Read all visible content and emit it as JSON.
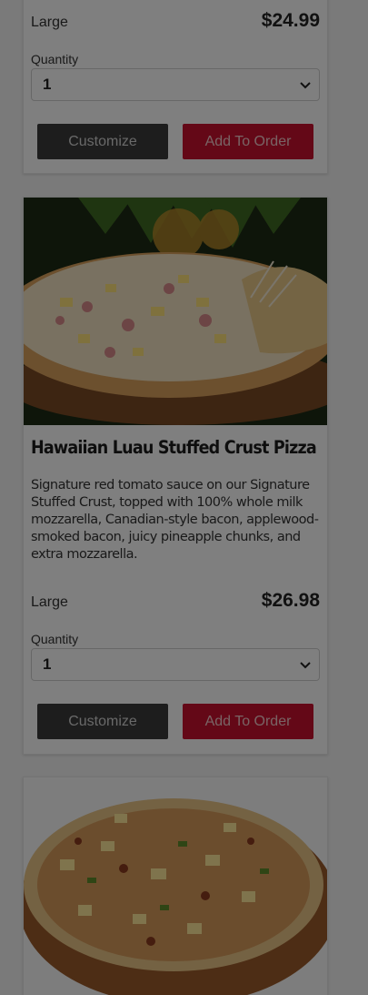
{
  "items": [
    {
      "size_label": "Large",
      "price": "$24.99",
      "quantity_label": "Quantity",
      "quantity_value": "1",
      "customize_label": "Customize",
      "add_label": "Add To Order"
    },
    {
      "name": "Hawaiian Luau Stuffed Crust Pizza",
      "description": "Signature red tomato sauce on our Signature Stuffed Crust, topped with 100% whole milk mozzarella, Canadian-style bacon, applewood-smoked bacon, juicy pineapple chunks, and extra mozzarella.",
      "size_label": "Large",
      "price": "$26.98",
      "quantity_label": "Quantity",
      "quantity_value": "1",
      "customize_label": "Customize",
      "add_label": "Add To Order"
    }
  ],
  "colors": {
    "add_button": "#c8102e",
    "customize_button": "#3a3a3a",
    "overlay": "rgba(0,0,0,0.5)"
  }
}
